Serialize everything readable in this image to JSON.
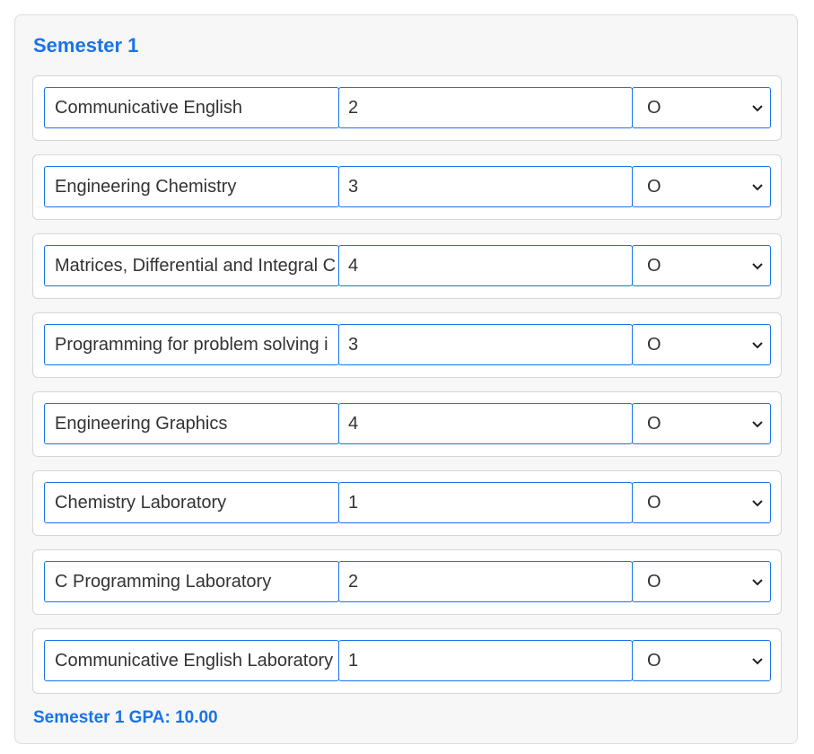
{
  "semester": {
    "title": "Semester 1",
    "rows": [
      {
        "subject": "Communicative English",
        "credits": "2",
        "grade": "O"
      },
      {
        "subject": "Engineering Chemistry",
        "credits": "3",
        "grade": "O"
      },
      {
        "subject": "Matrices, Differential and Integral C",
        "credits": "4",
        "grade": "O"
      },
      {
        "subject": "Programming for problem solving i",
        "credits": "3",
        "grade": "O"
      },
      {
        "subject": "Engineering Graphics",
        "credits": "4",
        "grade": "O"
      },
      {
        "subject": "Chemistry Laboratory",
        "credits": "1",
        "grade": "O"
      },
      {
        "subject": "C Programming Laboratory",
        "credits": "2",
        "grade": "O"
      },
      {
        "subject": "Communicative English Laboratory",
        "credits": "1",
        "grade": "O"
      }
    ],
    "gpa_label": "Semester 1 GPA:",
    "gpa_value": "10.00"
  },
  "colors": {
    "accent": "#1a73e8",
    "card_bg": "#f7f7f7",
    "text": "#333333"
  }
}
